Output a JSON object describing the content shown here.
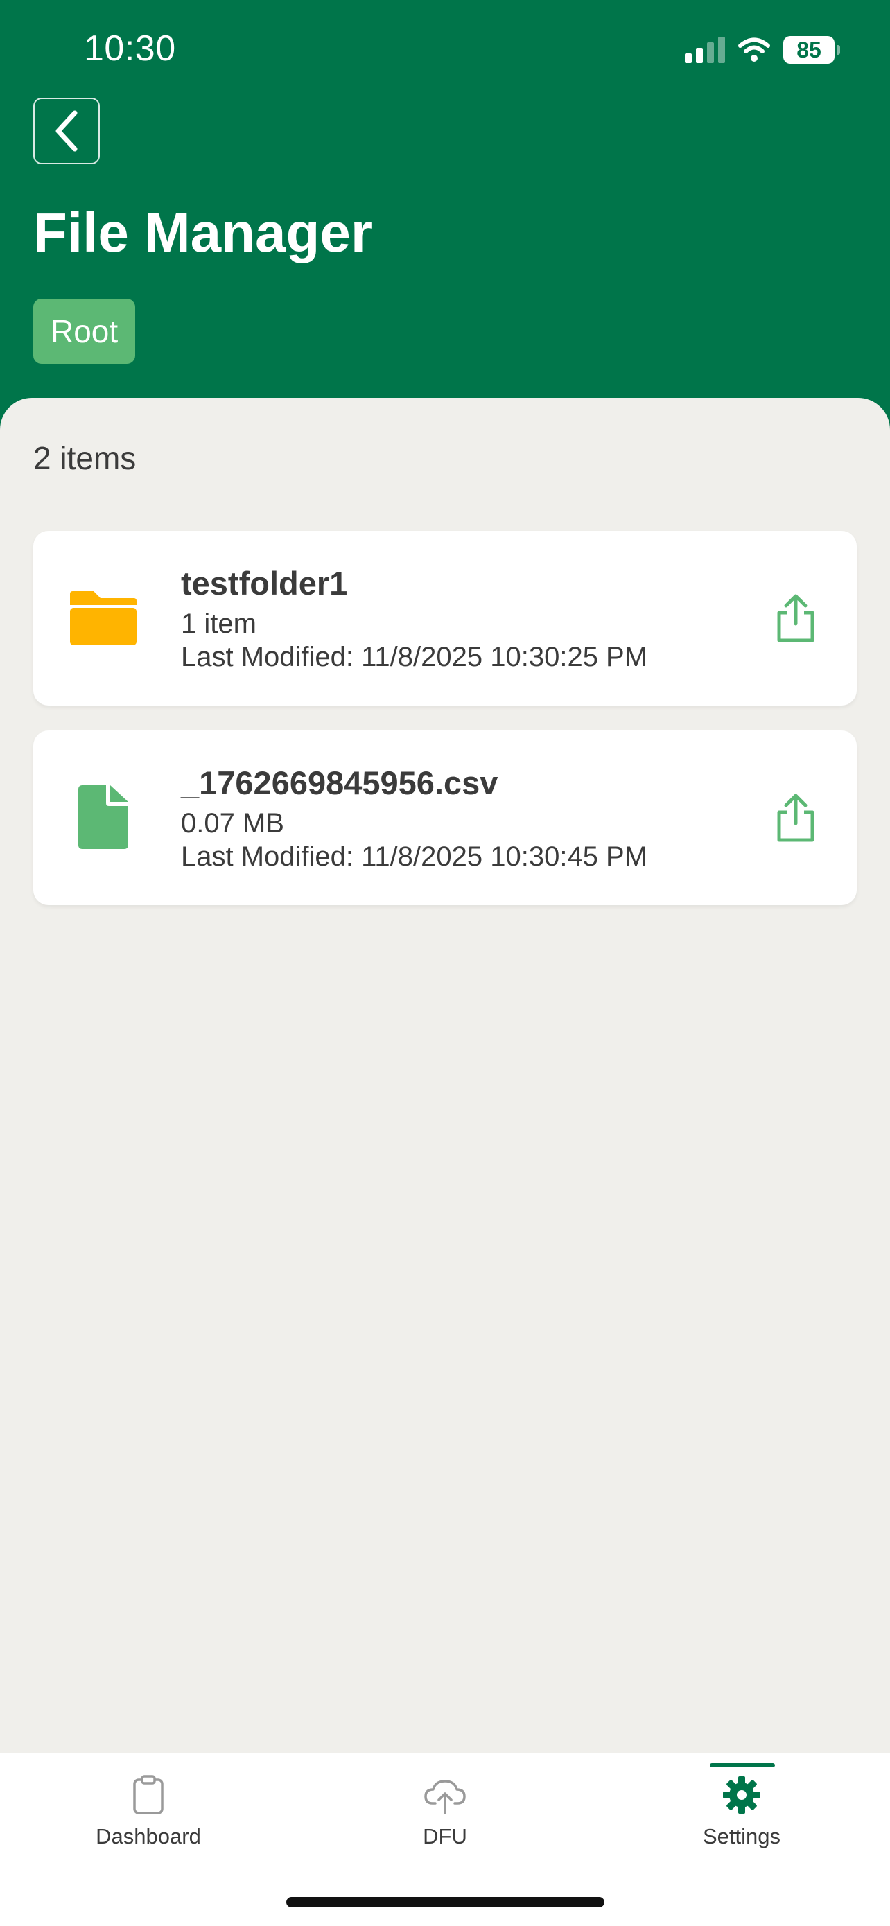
{
  "status_bar": {
    "time": "10:30",
    "battery": "85"
  },
  "header": {
    "title": "File Manager",
    "breadcrumb": "Root"
  },
  "content": {
    "count": "2 items",
    "items": [
      {
        "name": "testfolder1",
        "detail": "1 item",
        "modified": "Last Modified: 11/8/2025 10:30:25 PM",
        "icon": "folder-icon"
      },
      {
        "name": "_1762669845956.csv",
        "detail": "0.07 MB",
        "modified": "Last Modified: 11/8/2025 10:30:45 PM",
        "icon": "file-icon"
      }
    ]
  },
  "tabs": [
    {
      "label": "Dashboard",
      "icon": "clipboard-icon"
    },
    {
      "label": "DFU",
      "icon": "cloud-upload-icon"
    },
    {
      "label": "Settings",
      "icon": "gear-icon",
      "active": true
    }
  ],
  "colors": {
    "primary": "#00754a",
    "breadcrumb": "#5cb874",
    "folder": "#ffb400",
    "file": "#5cb874"
  }
}
